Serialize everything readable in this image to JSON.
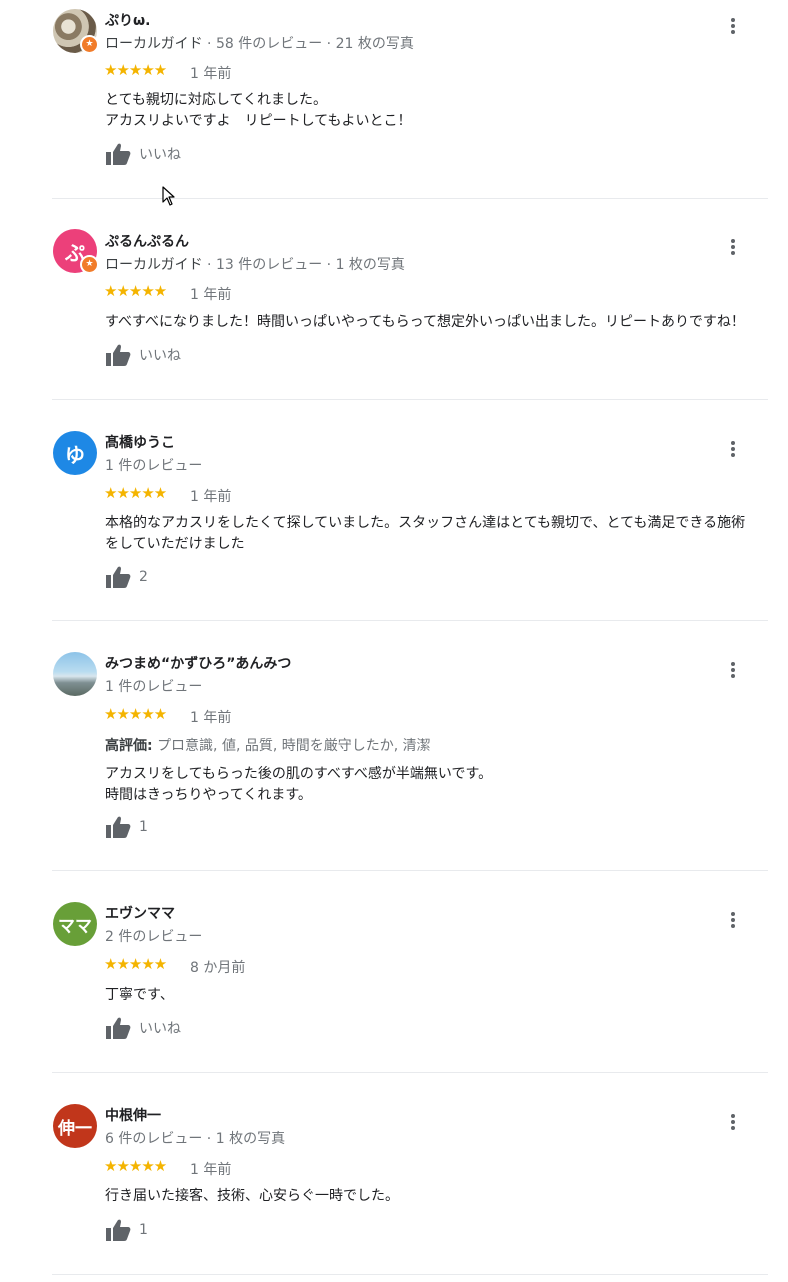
{
  "reviews": [
    {
      "name": "ぷりω.",
      "avatar_letter": "",
      "avatar_color": "",
      "local_guide": true,
      "guide_label": "ローカルガイド",
      "meta": "58 件のレビュー · 21 枚の写真",
      "stars": "★★★★★",
      "date": "1 年前",
      "highlights_label": "",
      "highlights": "",
      "text_lines": [
        "とても親切に対応してくれました。",
        "アカスリよいですよ　リピートしてもよいとこ！"
      ],
      "like_label": "いいね"
    },
    {
      "name": "ぷるんぷるん",
      "avatar_letter": "ぷ",
      "avatar_color": "#ec407a",
      "local_guide": true,
      "guide_label": "ローカルガイド",
      "meta": "13 件のレビュー · 1 枚の写真",
      "stars": "★★★★★",
      "date": "1 年前",
      "highlights_label": "",
      "highlights": "",
      "text_lines": [
        "すべすべになりました！時間いっぱいやってもらって想定外いっぱい出ました。リピートありですね！"
      ],
      "like_label": "いいね"
    },
    {
      "name": "髙橋ゆうこ",
      "avatar_letter": "ゆ",
      "avatar_color": "#1e88e5",
      "local_guide": false,
      "guide_label": "",
      "meta": "1 件のレビュー",
      "stars": "★★★★★",
      "date": "1 年前",
      "highlights_label": "",
      "highlights": "",
      "text_lines": [
        "本格的なアカスリをしたくて探していました。スタッフさん達はとても親切で、とても満足できる施術",
        "をしていただけました"
      ],
      "like_label": "2"
    },
    {
      "name": "みつまめ“かずひろ”あんみつ",
      "avatar_letter": "",
      "avatar_color": "",
      "local_guide": false,
      "guide_label": "",
      "meta": "1 件のレビュー",
      "stars": "★★★★★",
      "date": "1 年前",
      "highlights_label": "高評価:",
      "highlights": "プロ意識, 値, 品質, 時間を厳守したか, 清潔",
      "text_lines": [
        "アカスリをしてもらった後の肌のすべすべ感が半端無いです。",
        "時間はきっちりやってくれます。"
      ],
      "like_label": "1"
    },
    {
      "name": "エヴンママ",
      "avatar_letter": "ママ",
      "avatar_color": "#689f38",
      "local_guide": false,
      "guide_label": "",
      "meta": "2 件のレビュー",
      "stars": "★★★★★",
      "date": "8 か月前",
      "highlights_label": "",
      "highlights": "",
      "text_lines": [
        "丁寧です、"
      ],
      "like_label": "いいね"
    },
    {
      "name": "中根伸一",
      "avatar_letter": "伸一",
      "avatar_color": "#c1361b",
      "local_guide": false,
      "guide_label": "",
      "meta": "6 件のレビュー · 1 枚の写真",
      "stars": "★★★★★",
      "date": "1 年前",
      "highlights_label": "",
      "highlights": "",
      "text_lines": [
        "行き届いた接客、技術、心安らぐ一時でした。"
      ],
      "like_label": "1"
    }
  ]
}
